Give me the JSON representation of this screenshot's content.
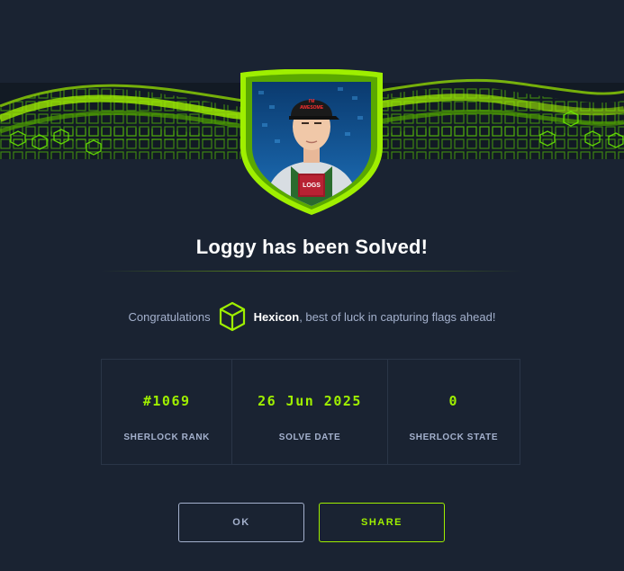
{
  "modal": {
    "title": "Loggy has been Solved!",
    "congrats_prefix": "Congratulations",
    "username": "Hexicon",
    "congrats_suffix": ", best of luck in capturing flags ahead!",
    "badge": {
      "icon": "sherlock-badge-icon",
      "cap_text_line1": "I'M",
      "cap_text_line2": "AWESOME",
      "book_text": "LOGS"
    },
    "stats": [
      {
        "value": "#1069",
        "label": "SHERLOCK RANK"
      },
      {
        "value": "26 Jun 2025",
        "label": "SOLVE DATE"
      },
      {
        "value": "0",
        "label": "SHERLOCK STATE"
      }
    ],
    "buttons": {
      "ok_label": "OK",
      "share_label": "SHARE"
    }
  },
  "colors": {
    "background": "#1a2332",
    "accent": "#9fef00",
    "text_muted": "#a4b1cd",
    "text_white": "#ffffff"
  }
}
